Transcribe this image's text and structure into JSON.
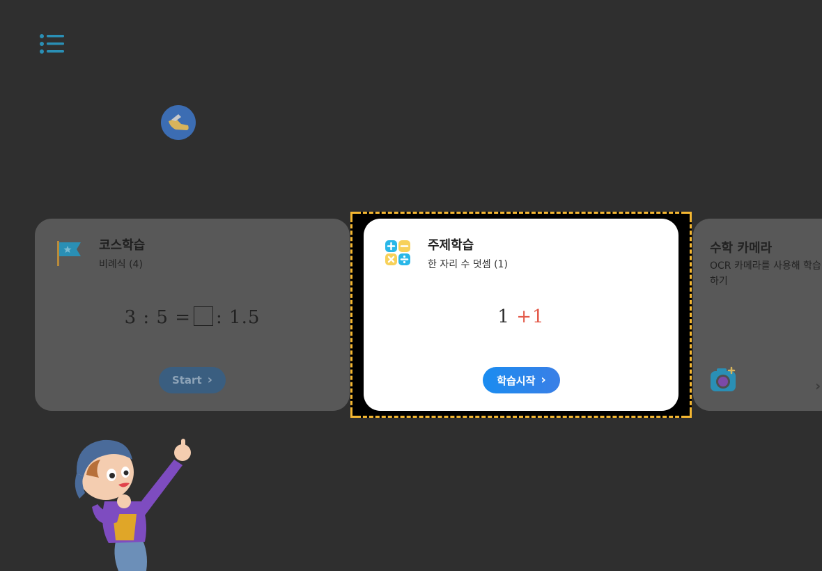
{
  "nav": {
    "menu_icon": "hamburger-list-icon",
    "badge_icon": "shoe-badge-icon"
  },
  "colors": {
    "background": "#2f2f2f",
    "accent_blue": "#1a8cf0",
    "focus_border": "#f5b731",
    "operator_red": "#e35a4a"
  },
  "cards": {
    "course": {
      "title": "코스학습",
      "subtitle": "비례식 (4)",
      "icon": "flag-icon",
      "equation": {
        "left": "3 : 5 =",
        "right": ": 1.5"
      },
      "button_label": "Start",
      "button_chevron": "›"
    },
    "topic": {
      "title": "주제학습",
      "subtitle": "한 자리 수 덧셈 (1)",
      "icon": "calculator-icon",
      "equation": {
        "a": "1",
        "op": "+",
        "b": "1"
      },
      "button_label": "학습시작",
      "button_chevron": "›"
    },
    "camera": {
      "title": "수학 카메라",
      "subtitle": "OCR 카메라를 사용해 학습하기",
      "icon": "camera-icon",
      "chevron": "›"
    }
  },
  "mascot": "boy-mascot-illustration"
}
